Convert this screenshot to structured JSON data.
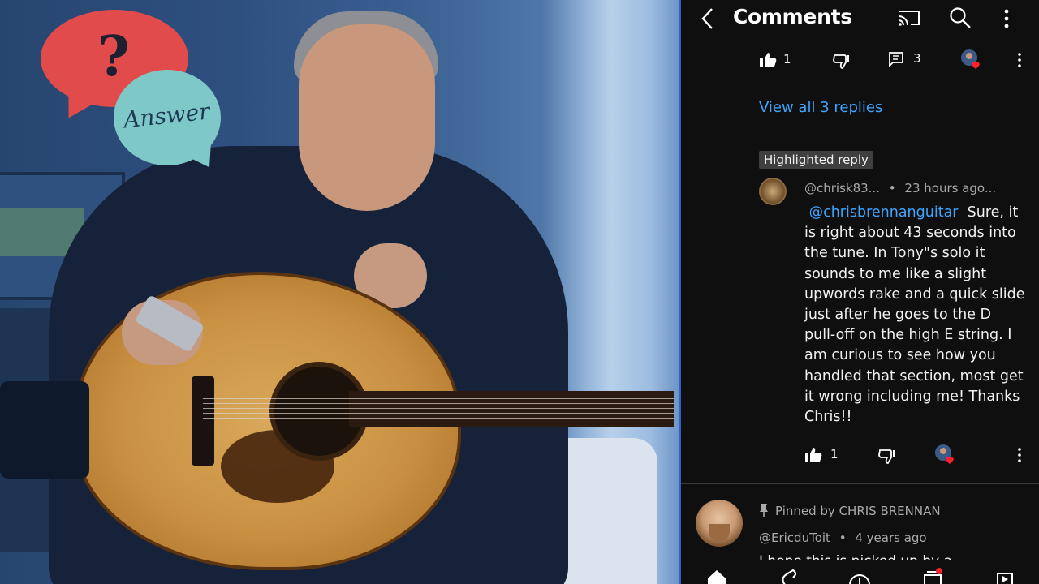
{
  "thumbnail": {
    "question_mark": "?",
    "answer_bubble_text": "Answer"
  },
  "comments_panel": {
    "title": "Comments",
    "top_comment_actions": {
      "like_count": "1",
      "reply_count": "3"
    },
    "view_replies": "View all 3 replies",
    "highlighted_badge": "Highlighted reply",
    "highlighted_reply": {
      "author": "@chrisk83...",
      "separator": "•",
      "time": "23 hours ago...",
      "mention": "@chrisbrennanguitar",
      "body": "Sure, it is right about 43 seconds into the tune. In Tony\"s solo it sounds to me like a slight upwords rake and a quick slide just after he goes to the D pull-off on the high E string. I am curious to see how you handled that section, most get it wrong including me! Thanks Chris!!",
      "like_count": "1"
    },
    "pinned_comment": {
      "pinned_label": "Pinned by CHRIS BRENNAN",
      "author": "@EricduToit",
      "separator": "•",
      "time": "4 years ago",
      "text": "I hope this is picked up by a"
    }
  },
  "colors": {
    "accent_link": "#3ea6ff",
    "heart": "#ff1f2d",
    "panel_border": "#2c62c8"
  },
  "icons": [
    "back-icon",
    "cast-icon",
    "search-icon",
    "more-vert-icon",
    "thumbs-up-icon",
    "thumbs-down-icon",
    "reply-icon",
    "creator-heart-icon",
    "pin-icon",
    "home-icon",
    "shorts-icon",
    "create-icon",
    "subscriptions-icon",
    "library-icon"
  ]
}
